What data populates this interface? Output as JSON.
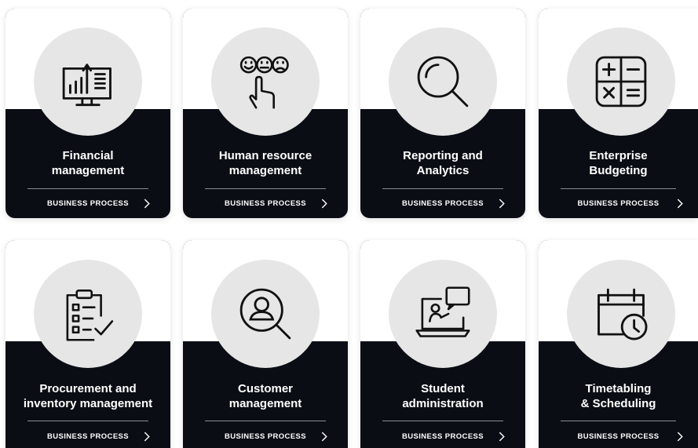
{
  "cards": [
    {
      "title_line1": "Financial",
      "title_line2": "management",
      "cta": "BUSINESS PROCESS",
      "icon": "financial-chart-icon"
    },
    {
      "title_line1": "Human resource",
      "title_line2": "management",
      "cta": "BUSINESS PROCESS",
      "icon": "feedback-hand-icon"
    },
    {
      "title_line1": "Reporting and",
      "title_line2": "Analytics",
      "cta": "BUSINESS PROCESS",
      "icon": "magnifier-icon"
    },
    {
      "title_line1": "Enterprise",
      "title_line2": "Budgeting",
      "cta": "BUSINESS PROCESS",
      "icon": "calculator-icon"
    },
    {
      "title_line1": "Procurement and",
      "title_line2": "inventory management",
      "cta": "BUSINESS PROCESS",
      "icon": "clipboard-checklist-icon"
    },
    {
      "title_line1": "Customer",
      "title_line2": "management",
      "cta": "BUSINESS PROCESS",
      "icon": "user-search-icon"
    },
    {
      "title_line1": "Student",
      "title_line2": "administration",
      "cta": "BUSINESS PROCESS",
      "icon": "laptop-lesson-icon"
    },
    {
      "title_line1": "Timetabling",
      "title_line2": "& Scheduling",
      "cta": "BUSINESS PROCESS",
      "icon": "calendar-clock-icon"
    }
  ],
  "colors": {
    "card_dark": "#0a0e14",
    "circle": "#e6e6e6",
    "text": "#ffffff"
  }
}
